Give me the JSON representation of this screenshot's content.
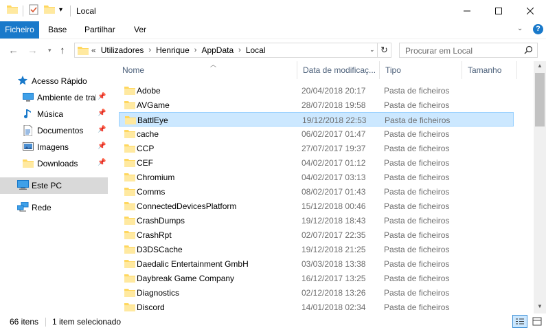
{
  "window": {
    "title": "Local",
    "accent_color": "#1979ca"
  },
  "quick_access_toolbar": {
    "icons": [
      "folder-icon",
      "properties-icon",
      "new-folder-icon",
      "dropdown-arrow-icon"
    ]
  },
  "ribbon": {
    "tabs": [
      {
        "label": "Ficheiro"
      },
      {
        "label": "Base"
      },
      {
        "label": "Partilhar"
      },
      {
        "label": "Ver"
      }
    ],
    "help_label": "?"
  },
  "navigation": {
    "breadcrumb_prefix": "«",
    "breadcrumbs": [
      "Utilizadores",
      "Henrique",
      "AppData",
      "Local"
    ],
    "search_placeholder": "Procurar em Local"
  },
  "sidebar": {
    "items": [
      {
        "label": "Acesso Rápido",
        "icon": "star-icon",
        "pinned": false
      },
      {
        "label": "Ambiente de trabalho",
        "icon": "desktop-icon",
        "pinned": true
      },
      {
        "label": "Música",
        "icon": "music-icon",
        "pinned": true
      },
      {
        "label": "Documentos",
        "icon": "documents-icon",
        "pinned": true
      },
      {
        "label": "Imagens",
        "icon": "pictures-icon",
        "pinned": true
      },
      {
        "label": "Downloads",
        "icon": "folder-icon",
        "pinned": true
      },
      {
        "label": "Este PC",
        "icon": "computer-icon",
        "pinned": false
      },
      {
        "label": "Rede",
        "icon": "network-icon",
        "pinned": false
      }
    ]
  },
  "columns": {
    "name": "Nome",
    "date": "Data de modificaç...",
    "type": "Tipo",
    "size": "Tamanho"
  },
  "files": [
    {
      "name": "Adobe",
      "date": "20/04/2018 20:17",
      "type": "Pasta de ficheiros"
    },
    {
      "name": "AVGame",
      "date": "28/07/2018 19:58",
      "type": "Pasta de ficheiros"
    },
    {
      "name": "BattlEye",
      "date": "19/12/2018 22:53",
      "type": "Pasta de ficheiros"
    },
    {
      "name": "cache",
      "date": "06/02/2017 01:47",
      "type": "Pasta de ficheiros"
    },
    {
      "name": "CCP",
      "date": "27/07/2017 19:37",
      "type": "Pasta de ficheiros"
    },
    {
      "name": "CEF",
      "date": "04/02/2017 01:12",
      "type": "Pasta de ficheiros"
    },
    {
      "name": "Chromium",
      "date": "04/02/2017 03:13",
      "type": "Pasta de ficheiros"
    },
    {
      "name": "Comms",
      "date": "08/02/2017 01:43",
      "type": "Pasta de ficheiros"
    },
    {
      "name": "ConnectedDevicesPlatform",
      "date": "15/12/2018 00:46",
      "type": "Pasta de ficheiros"
    },
    {
      "name": "CrashDumps",
      "date": "19/12/2018 18:43",
      "type": "Pasta de ficheiros"
    },
    {
      "name": "CrashRpt",
      "date": "02/07/2017 22:35",
      "type": "Pasta de ficheiros"
    },
    {
      "name": "D3DSCache",
      "date": "19/12/2018 21:25",
      "type": "Pasta de ficheiros"
    },
    {
      "name": "Daedalic Entertainment GmbH",
      "date": "03/03/2018 13:38",
      "type": "Pasta de ficheiros"
    },
    {
      "name": "Daybreak Game Company",
      "date": "16/12/2017 13:25",
      "type": "Pasta de ficheiros"
    },
    {
      "name": "Diagnostics",
      "date": "02/12/2018 13:26",
      "type": "Pasta de ficheiros"
    },
    {
      "name": "Discord",
      "date": "14/01/2018 02:34",
      "type": "Pasta de ficheiros"
    }
  ],
  "selected_file": "BattlEye",
  "status": {
    "item_count": "66 itens",
    "selection": "1 item selecionado"
  }
}
